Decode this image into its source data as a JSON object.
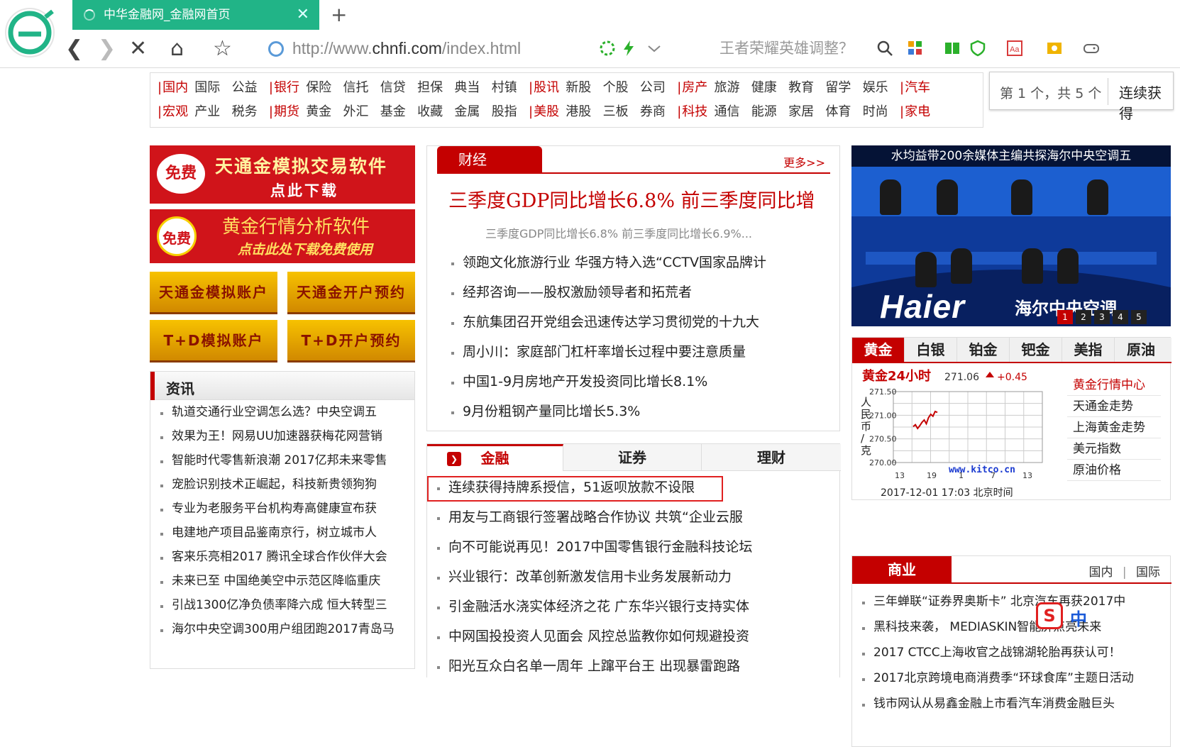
{
  "browser": {
    "tab_title": "中华金融网_金融网首页",
    "tab_close": "✕",
    "new_tab": "+",
    "back": "❮",
    "forward": "❯",
    "stop": "✕",
    "home": "⌂",
    "favorite": "☆",
    "url_prefix": "http://www.",
    "url_domain": "chnfi.com",
    "url_suffix": "/index.html",
    "search_placeholder": "王者荣耀英雄调整？"
  },
  "find_bar": {
    "count": "第 1 个，共 5 个",
    "query": "连续获得"
  },
  "category_nav": {
    "row1": [
      {
        "label": "国内",
        "red": true
      },
      {
        "label": "国际",
        "red": false
      },
      {
        "label": "公益",
        "red": false
      },
      {
        "label": "银行",
        "red": true
      },
      {
        "label": "保险",
        "red": false
      },
      {
        "label": "信托",
        "red": false
      },
      {
        "label": "信贷",
        "red": false
      },
      {
        "label": "担保",
        "red": false
      },
      {
        "label": "典当",
        "red": false
      },
      {
        "label": "村镇",
        "red": false
      },
      {
        "label": "股讯",
        "red": true
      },
      {
        "label": "新股",
        "red": false
      },
      {
        "label": "个股",
        "red": false
      },
      {
        "label": "公司",
        "red": false
      },
      {
        "label": "房产",
        "red": true
      },
      {
        "label": "旅游",
        "red": false
      },
      {
        "label": "健康",
        "red": false
      },
      {
        "label": "教育",
        "red": false
      },
      {
        "label": "留学",
        "red": false
      },
      {
        "label": "娱乐",
        "red": false
      },
      {
        "label": "汽车",
        "red": true
      }
    ],
    "row2": [
      {
        "label": "宏观",
        "red": true
      },
      {
        "label": "产业",
        "red": false
      },
      {
        "label": "税务",
        "red": false
      },
      {
        "label": "期货",
        "red": true
      },
      {
        "label": "黄金",
        "red": false
      },
      {
        "label": "外汇",
        "red": false
      },
      {
        "label": "基金",
        "red": false
      },
      {
        "label": "收藏",
        "red": false
      },
      {
        "label": "金属",
        "red": false
      },
      {
        "label": "股指",
        "red": false
      },
      {
        "label": "美股",
        "red": true
      },
      {
        "label": "港股",
        "red": false
      },
      {
        "label": "三板",
        "red": false
      },
      {
        "label": "券商",
        "red": false
      },
      {
        "label": "科技",
        "red": true
      },
      {
        "label": "通信",
        "red": false
      },
      {
        "label": "能源",
        "red": false
      },
      {
        "label": "家居",
        "red": false
      },
      {
        "label": "体育",
        "red": false
      },
      {
        "label": "时尚",
        "red": false
      },
      {
        "label": "家电",
        "red": true
      }
    ]
  },
  "ads": {
    "ad1_badge": "免费",
    "ad1_title": "天通金模拟交易软件",
    "ad1_sub": "点此下载",
    "ad2_badge": "免费",
    "ad2_title": "黄金行情分析软件",
    "ad2_sub": "点击此处下载免费使用",
    "btn1": "天通金模拟账户",
    "btn2": "天通金开户预约",
    "btn3": "T+D模拟账户",
    "btn4": "T+D开户预约"
  },
  "news_section": {
    "title": "资讯",
    "items": [
      "轨道交通行业空调怎么选？中央空调五",
      "效果为王！网易UU加速器获梅花网营销",
      "智能时代零售新浪潮 2017亿邦未来零售",
      "宠脸识别技术正崛起，科技新贵领狗狗",
      "专业为老服务平台机构寿高健康宣布获",
      "电建地产项目品鉴南京行，树立城市人",
      "客来乐亮相2017 腾讯全球合作伙伴大会",
      "未来已至 中国绝美空中示范区降临重庆",
      "引战1300亿净负债率降六成 恒大转型三",
      "海尔中央空调300用户组团跑2017青岛马"
    ]
  },
  "finance_section": {
    "tab": "财经",
    "more": "更多>>",
    "headline": "三季度GDP同比增长6.8% 前三季度同比增",
    "subline": "三季度GDP同比增长6.8% 前三季度同比增长6.9%...",
    "items": [
      "领跑文化旅游行业 华强方特入选“CCTV国家品牌计",
      "经邦咨询——股权激励领导者和拓荒者",
      "东航集团召开党组会迅速传达学习贯彻党的十九大",
      "周小川：家庭部门杠杆率增长过程中要注意质量",
      "中国1-9月房地产开发投资同比增长8.1%",
      "9月份粗钢产量同比增长5.3%"
    ]
  },
  "jr_section": {
    "tabs": [
      "金融",
      "证券",
      "理财"
    ],
    "tab_icon": "❯",
    "items": [
      "连续获得持牌系授信，51返呗放款不设限",
      "用友与工商银行签署战略合作协议 共筑“企业云服",
      "向不可能说再见！2017中国零售银行金融科技论坛",
      "兴业银行：改革创新激发信用卡业务发展新动力",
      "引金融活水浇实体经济之花 广东华兴银行支持实体",
      "中网国投投资人见面会 风控总监教你如何规避投资",
      "阳光互众白名单一周年 上蹿平台王 出现暴雷跑路"
    ]
  },
  "banner": {
    "title": "水均益带200余媒体主编共探海尔中央空调五",
    "brand": "Haier",
    "brand_cn": "海尔中央空调",
    "pages": [
      "1",
      "2",
      "3",
      "4",
      "5"
    ]
  },
  "gold_section": {
    "tabs": [
      "黄金",
      "白银",
      "铂金",
      "钯金",
      "美指",
      "原油"
    ],
    "chart_title": "黄金24小时",
    "price": "271.06",
    "change": "+0.45",
    "y_ticks": [
      "271.50",
      "271.00",
      "270.50",
      "270.00"
    ],
    "y_unit": [
      "人",
      "民",
      "币",
      "/",
      "克"
    ],
    "x_ticks": [
      "13",
      "19",
      "1",
      "7",
      "13"
    ],
    "source": "www.kitco.cn",
    "timestamp": "2017-12-01 17:03 北京时间",
    "links": [
      "黄金行情中心",
      "天通金走势",
      "上海黄金走势",
      "美元指数",
      "原油价格"
    ]
  },
  "business_section": {
    "tab": "商业",
    "link1": "国内",
    "divider": "|",
    "link2": "国际",
    "items": [
      "三年蝉联“证券界奥斯卡” 北京汽车再获2017中",
      "黑科技来袭， MEDIASKIN智能屏点亮未来",
      "2017 CTCC上海收官之战锦湖轮胎再获认可！",
      "2017北京跨境电商消费季“环球食库”主题日活动",
      "钱市网认从易鑫金融上市看汽车消费金融巨头"
    ]
  },
  "ime": {
    "logo": "S",
    "lang": "中"
  },
  "colors": {
    "accent": "#c40000",
    "tab_green": "#21b487",
    "gold": "#f0b400"
  },
  "chart_data": {
    "type": "line",
    "title": "黄金24小时",
    "x_ticks": [
      "13",
      "19",
      "1",
      "7",
      "13"
    ],
    "ylim": [
      270.0,
      271.5
    ],
    "y_ticks": [
      271.5,
      271.0,
      270.5,
      270.0
    ],
    "series": [
      {
        "values": [
          270.76,
          270.8,
          270.72,
          270.78,
          270.85,
          270.9,
          270.82,
          270.95,
          271.02,
          270.98,
          271.08,
          271.06
        ]
      }
    ]
  }
}
